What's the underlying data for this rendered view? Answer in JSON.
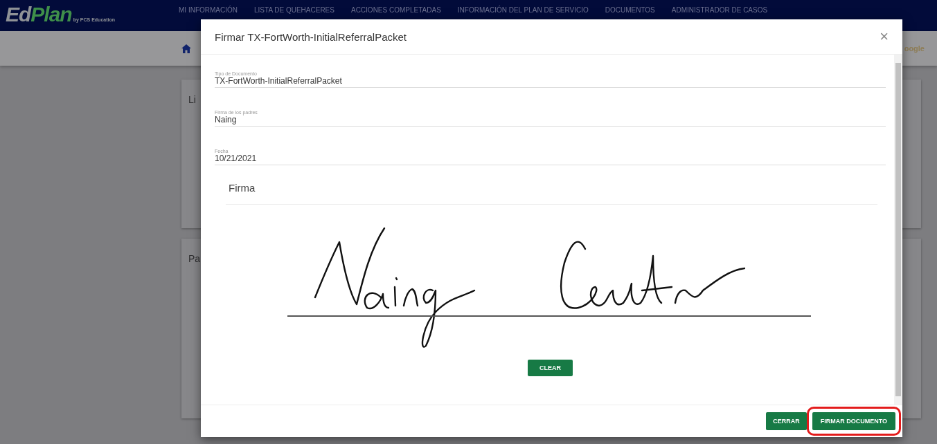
{
  "logo": {
    "part_1": "Ed",
    "part_2": "Plan",
    "tagline": "by PCS Education"
  },
  "nav": [
    {
      "label": "MI INFORMACIÓN"
    },
    {
      "label": "LISTA DE QUEHACERES"
    },
    {
      "label": "ACCIONES COMPLETADAS"
    },
    {
      "label": "INFORMACIÓN DEL PLAN DE SERVICIO"
    },
    {
      "label": "DOCUMENTOS"
    },
    {
      "label": "ADMINISTRADOR DE CASOS"
    }
  ],
  "toolbar": {
    "right_text": "oogle"
  },
  "cards": [
    {
      "title": "Li"
    },
    {
      "title": "Pa"
    }
  ],
  "dialog": {
    "title": "Firmar TX-FortWorth-InitialReferralPacket",
    "close": "×",
    "fields": [
      {
        "label": "Tipo de Documento",
        "value": "TX-FortWorth-InitialReferralPacket"
      },
      {
        "label": "Firma de los padres",
        "value": "Naing"
      },
      {
        "label": "Fecha",
        "value": "10/21/2021"
      }
    ],
    "signature_label": "Firma",
    "clear_button": "CLEAR",
    "buttons": [
      {
        "label": "CERRAR",
        "highlighted": false
      },
      {
        "label": "FIRMAR DOCUMENTO",
        "highlighted": true
      }
    ]
  }
}
